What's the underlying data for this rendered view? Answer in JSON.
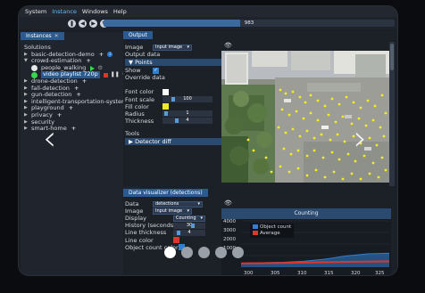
{
  "menu": {
    "items": [
      "System",
      "Instance",
      "Windows",
      "Help"
    ],
    "active": "Instance"
  },
  "toolbar": {
    "frame_counter": "983",
    "progress": 0.47
  },
  "instances": {
    "tab_label": "Instances",
    "solutions_label": "Solutions",
    "items": [
      "basic-detection-demo",
      "crowd-estimation",
      "people_walking",
      "video playlist 720p",
      "drone-detection",
      "fall-detection",
      "gun-detection",
      "intelligent-transportation-systems",
      "playground",
      "privacy",
      "security",
      "smart-home"
    ]
  },
  "output": {
    "tab_label": "Output",
    "image_label": "Image",
    "image_value": "Input image",
    "output_data_label": "Output data",
    "points_section": "Points",
    "show_label": "Show",
    "override_label": "Override data",
    "font_color_label": "Font color",
    "font_scale_label": "Font scale",
    "font_scale_value": "100",
    "fill_color_label": "Fill color",
    "radius_label": "Radius",
    "radius_value": "1",
    "thickness_label": "Thickness",
    "thickness_value": "4",
    "tools_label": "Tools",
    "detector_diff_label": "Detector diff",
    "font_color": "#ffffff",
    "fill_color": "#f2e82a"
  },
  "visualizer": {
    "tab_label": "Data visualizer (detections)",
    "data_label": "Data",
    "data_value": "detections",
    "image_label": "Image",
    "image_value": "Input image",
    "display_label": "Display",
    "display_value": "Counting",
    "history_label": "History (seconds)",
    "history_value": "30",
    "line_thickness_label": "Line thickness",
    "line_thickness_value": "4",
    "line_color_label": "Line color",
    "object_count_color_label": "Object count color",
    "line_color": "#e0342c",
    "object_count_color": "#2f7fd3"
  },
  "chart_data": {
    "type": "area",
    "title": "Counting",
    "ylim": [
      0,
      4000
    ],
    "y_ticks": [
      "4000",
      "3000",
      "2000",
      "1000"
    ],
    "x_ticks": [
      "300",
      "305",
      "310",
      "315",
      "320",
      "325"
    ],
    "series": [
      {
        "name": "Object count",
        "color": "#2f7fd3",
        "x": [
          298,
          302,
          306,
          310,
          314,
          318,
          322,
          326
        ],
        "values": [
          350,
          380,
          420,
          520,
          700,
          980,
          1150,
          1200
        ]
      },
      {
        "name": "Average",
        "color": "#e0342c",
        "x": [
          298,
          302,
          306,
          310,
          314,
          318,
          322,
          326
        ],
        "values": [
          330,
          350,
          370,
          400,
          430,
          460,
          480,
          500
        ]
      }
    ],
    "legend": "top-left",
    "grid": true
  },
  "carousel": {
    "prev": "‹",
    "next": "›",
    "count": 5,
    "active": 0
  }
}
